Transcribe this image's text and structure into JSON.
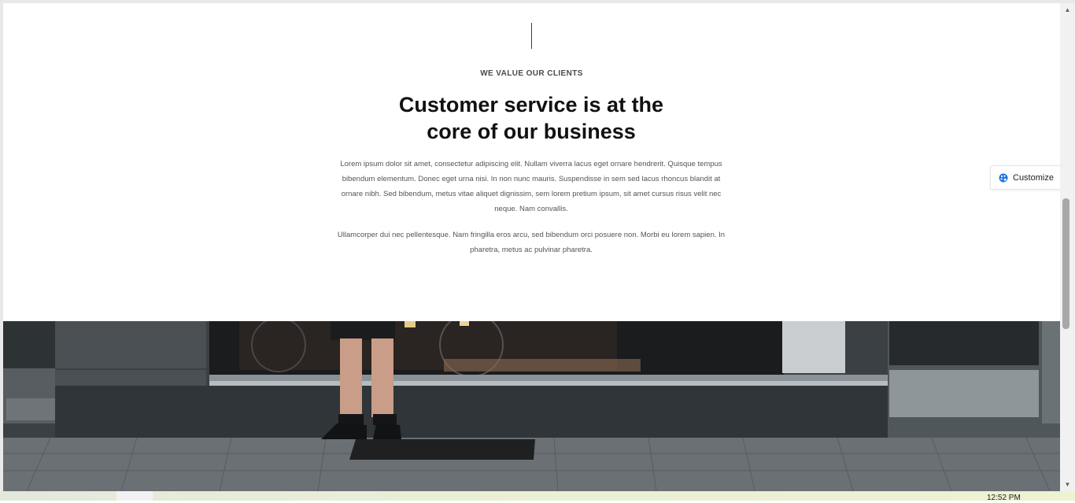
{
  "section": {
    "eyebrow": "WE VALUE OUR CLIENTS",
    "headline_line1": "Customer service is at the",
    "headline_line2": "core of our business",
    "paragraph1": "Lorem ipsum dolor sit amet, consectetur adipiscing elit. Nullam viverra lacus eget ornare hendrerit. Quisque tempus bibendum elementum. Donec eget urna nisi. In non nunc mauris. Suspendisse in sem sed lacus rhoncus blandit at ornare nibh. Sed bibendum, metus vitae aliquet dignissim, sem lorem pretium ipsum, sit amet cursus risus velit nec neque. Nam convallis.",
    "paragraph2": "Ullamcorper dui nec pellentesque. Nam fringilla eros arcu, sed bibendum orci posuere non. Morbi eu lorem sapien. In pharetra, metus ac pulvinar pharetra.",
    "accent_color": "#8b1a1a"
  },
  "customize": {
    "label": "Customize",
    "icon": "palette-icon",
    "icon_color": "#1a73e8"
  },
  "photo": {
    "description_icon": "storefront-photo"
  },
  "scrollbar": {
    "up_icon": "▲",
    "down_icon": "▼",
    "position": 0.47
  },
  "taskbar": {
    "clock": "12:52 PM"
  }
}
